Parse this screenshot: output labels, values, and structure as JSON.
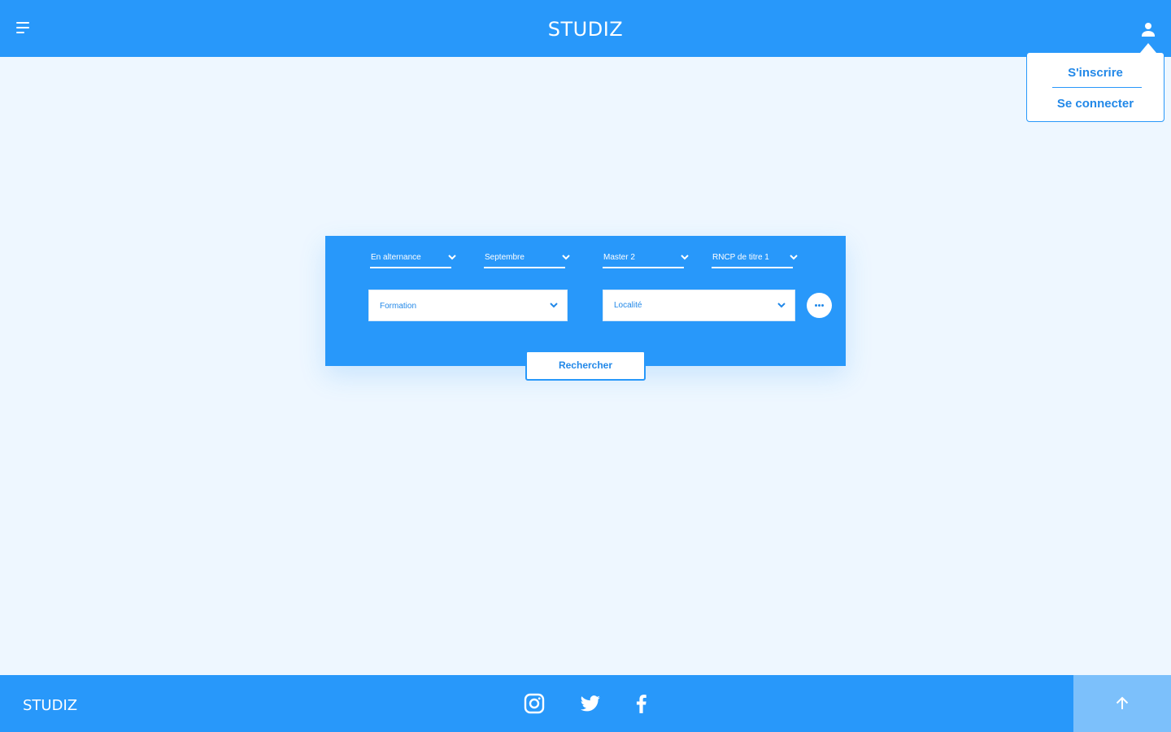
{
  "header": {
    "brand": "STUDIZ",
    "menu_icon": "menu-icon",
    "user_icon": "user-icon"
  },
  "account_menu": {
    "items": [
      {
        "label": "S'inscrire"
      },
      {
        "label": "Se connecter"
      }
    ]
  },
  "search": {
    "filters": [
      {
        "label": "En alternance"
      },
      {
        "label": "Septembre"
      },
      {
        "label": "Master 2"
      },
      {
        "label": "RNCP de titre 1"
      }
    ],
    "formation": {
      "label": "Formation"
    },
    "localite": {
      "label": "Localité"
    },
    "more_icon": "more-dots-icon",
    "submit_label": "Rechercher"
  },
  "footer": {
    "brand": "STUDIZ",
    "social": [
      "instagram-icon",
      "twitter-icon",
      "facebook-icon"
    ],
    "to_top_icon": "arrow-up-icon"
  },
  "colors": {
    "primary": "#2898fa",
    "accent_text": "#2288e8",
    "background": "#eef7ff",
    "to_top": "#7cc0fb"
  }
}
